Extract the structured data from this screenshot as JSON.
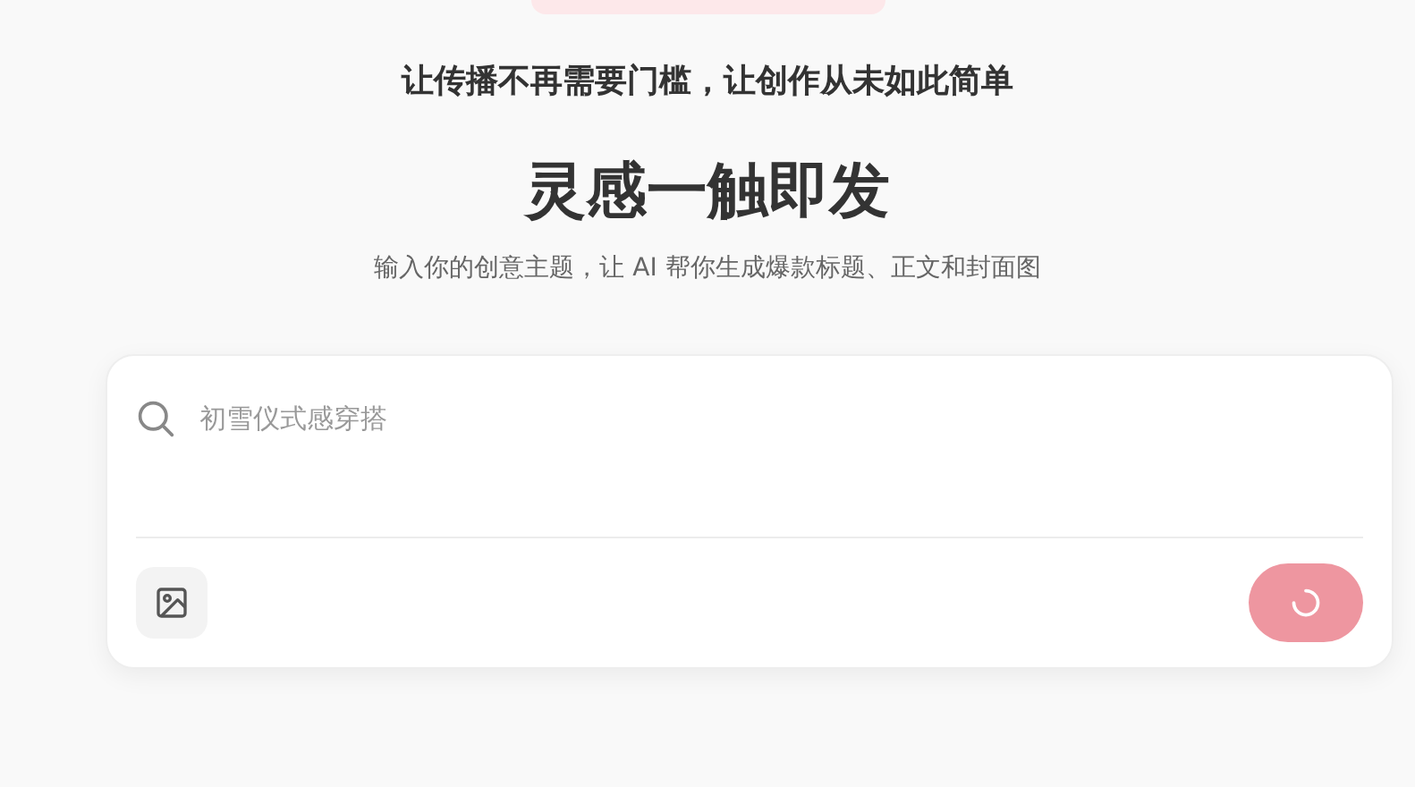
{
  "tagline": "让传播不再需要门槛，让创作从未如此简单",
  "title": "灵感一触即发",
  "subtitle": "输入你的创意主题，让 AI 帮你生成爆款标题、正文和封面图",
  "prompt": {
    "placeholder": "初雪仪式感穿搭",
    "loading": true
  }
}
